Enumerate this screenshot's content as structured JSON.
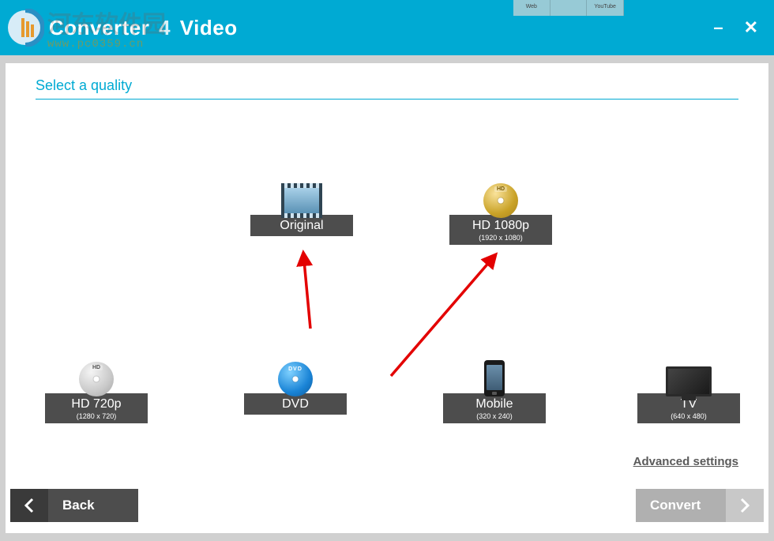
{
  "app": {
    "title_left": "Converter",
    "title_mid": "4",
    "title_right": "Video"
  },
  "watermark": {
    "cn": "河东软件园",
    "url": "www.pc0359.cn"
  },
  "heading": "Select a quality",
  "options": {
    "original": {
      "label": "Original",
      "sub": ""
    },
    "hd1080": {
      "label": "HD 1080p",
      "sub": "(1920 x 1080)"
    },
    "hd720": {
      "label": "HD 720p",
      "sub": "(1280 x 720)"
    },
    "dvd": {
      "label": "DVD",
      "sub": ""
    },
    "mobile": {
      "label": "Mobile",
      "sub": "(320 x 240)"
    },
    "tv": {
      "label": "TV",
      "sub": "(640 x 480)"
    }
  },
  "advanced": "Advanced settings",
  "footer": {
    "back": "Back",
    "convert": "Convert"
  },
  "top_tabs": [
    "Web",
    "",
    "YouTube"
  ]
}
